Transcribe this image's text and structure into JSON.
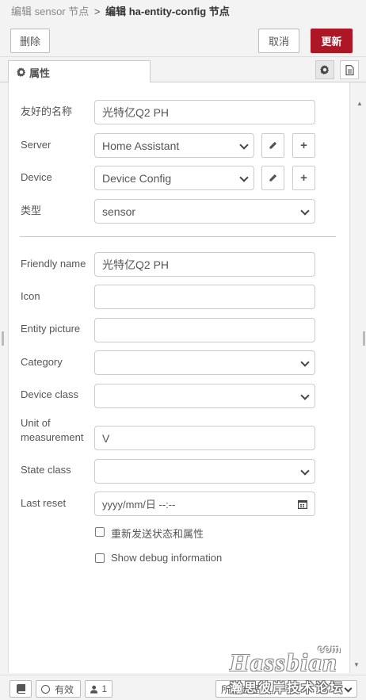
{
  "breadcrumb": {
    "parent": "编辑 sensor 节点",
    "separator": ">",
    "current": "编辑 ha-entity-config 节点"
  },
  "toolbar": {
    "delete_label": "删除",
    "cancel_label": "取消",
    "update_label": "更新",
    "update_color": "#ad1625"
  },
  "tabs": {
    "properties_label": "属性"
  },
  "form": {
    "friendly_name_cn": {
      "label": "友好的名称",
      "value": "光特亿Q2 PH"
    },
    "server": {
      "label": "Server",
      "value": "Home Assistant"
    },
    "device": {
      "label": "Device",
      "value": "Device Config"
    },
    "type": {
      "label": "类型",
      "value": "sensor"
    },
    "friendly_name": {
      "label": "Friendly name",
      "value": "光特亿Q2 PH"
    },
    "icon": {
      "label": "Icon",
      "value": ""
    },
    "entity_picture": {
      "label": "Entity picture",
      "value": ""
    },
    "category": {
      "label": "Category",
      "value": ""
    },
    "device_class": {
      "label": "Device class",
      "value": ""
    },
    "unit": {
      "label_line1": "Unit of",
      "label_line2": "measurement",
      "value": "V"
    },
    "state_class": {
      "label": "State class",
      "value": ""
    },
    "last_reset": {
      "label": "Last reset",
      "placeholder": "yyyy/mm/日 --:--"
    },
    "resend_checkbox": {
      "label": "重新发送状态和属性",
      "checked": false
    },
    "debug_checkbox": {
      "label": "Show debug information",
      "checked": false
    }
  },
  "footer": {
    "valid_label": "有效",
    "user_count": "1",
    "scope_select": "所有流程"
  },
  "watermark": {
    "logo": "Hassbian",
    "com": "com",
    "sub": "瀚思彼岸技术论坛"
  },
  "icons": {
    "gear": "gear-icon",
    "doc": "document-icon",
    "pencil": "pencil-icon",
    "plus": "plus-icon",
    "calendar": "calendar-icon",
    "book": "book-icon",
    "user": "user-icon"
  }
}
